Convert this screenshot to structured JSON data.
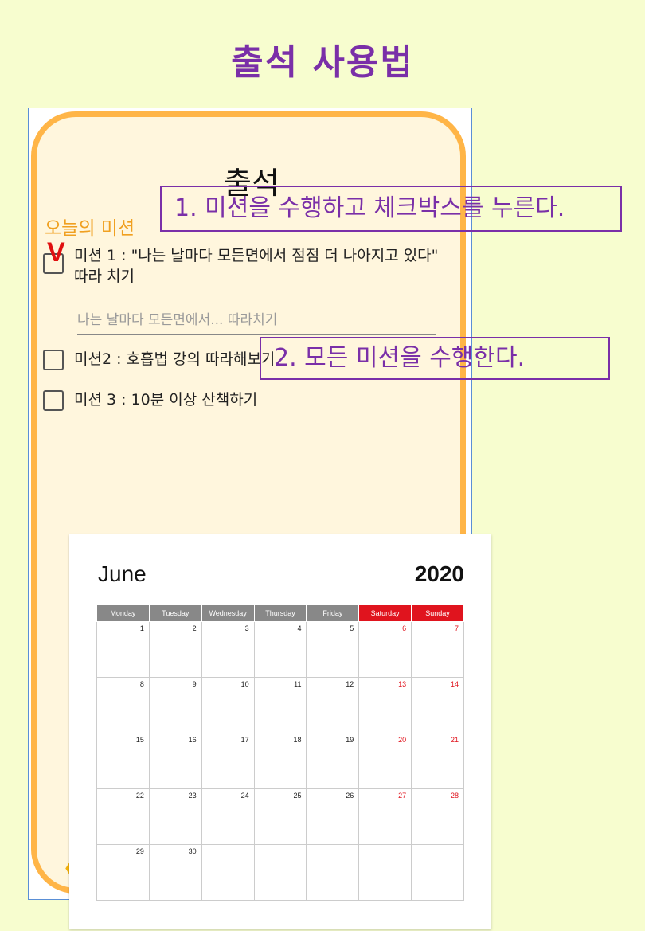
{
  "page_title": "출석 사용법",
  "app": {
    "title": "출석",
    "mission_heading": "오늘의 미션",
    "check_mark": "V",
    "missions": [
      {
        "label": "미션 1 : \"나는 날마다 모든면에서 점점 더 나아지고 있다\"",
        "label_line2": "따라 치기",
        "checked": true
      },
      {
        "label": "미션2 : 호흡법 강의 따라해보기",
        "checked": false
      },
      {
        "label": "미션 3 : 10분 이상 산책하기",
        "checked": false
      }
    ],
    "input_placeholder": "나는 날마다 모든면에서... 따라치기",
    "back_icon": "chevron-left-icon"
  },
  "callouts": {
    "step1": "1. 미션을 수행하고 체크박스를 누른다.",
    "step2": "2. 모든 미션을 수행한다."
  },
  "calendar": {
    "month": "June",
    "year": "2020",
    "weekdays": [
      "Monday",
      "Tuesday",
      "Wednesday",
      "Thursday",
      "Friday",
      "Saturday",
      "Sunday"
    ],
    "weeks": [
      [
        "1",
        "2",
        "3",
        "4",
        "5",
        "6",
        "7"
      ],
      [
        "8",
        "9",
        "10",
        "11",
        "12",
        "13",
        "14"
      ],
      [
        "15",
        "16",
        "17",
        "18",
        "19",
        "20",
        "21"
      ],
      [
        "22",
        "23",
        "24",
        "25",
        "26",
        "27",
        "28"
      ],
      [
        "29",
        "30",
        "",
        "",
        "",
        "",
        ""
      ]
    ]
  },
  "colors": {
    "title": "#7a2fa8",
    "accent": "#ffb547",
    "weekend": "#e0141e",
    "page_bg": "#f7fdcf"
  }
}
